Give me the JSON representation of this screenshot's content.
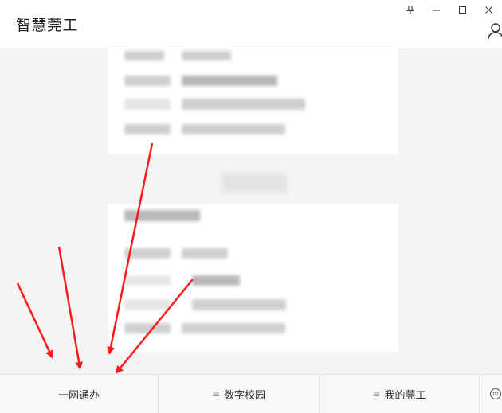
{
  "header": {
    "title": "智慧莞工"
  },
  "window_controls": {
    "pin": "pin-icon",
    "minimize": "minimize-icon",
    "maximize": "maximize-icon",
    "close": "close-icon"
  },
  "tabs": [
    {
      "label": "一网通办",
      "icon": ""
    },
    {
      "label": "数字校园",
      "icon": "≡"
    },
    {
      "label": "我的莞工",
      "icon": "≡"
    }
  ],
  "colors": {
    "arrow": "#ff1a1a",
    "tab_bar_bg": "#f8f8f8",
    "content_bg": "#f4f4f4"
  }
}
